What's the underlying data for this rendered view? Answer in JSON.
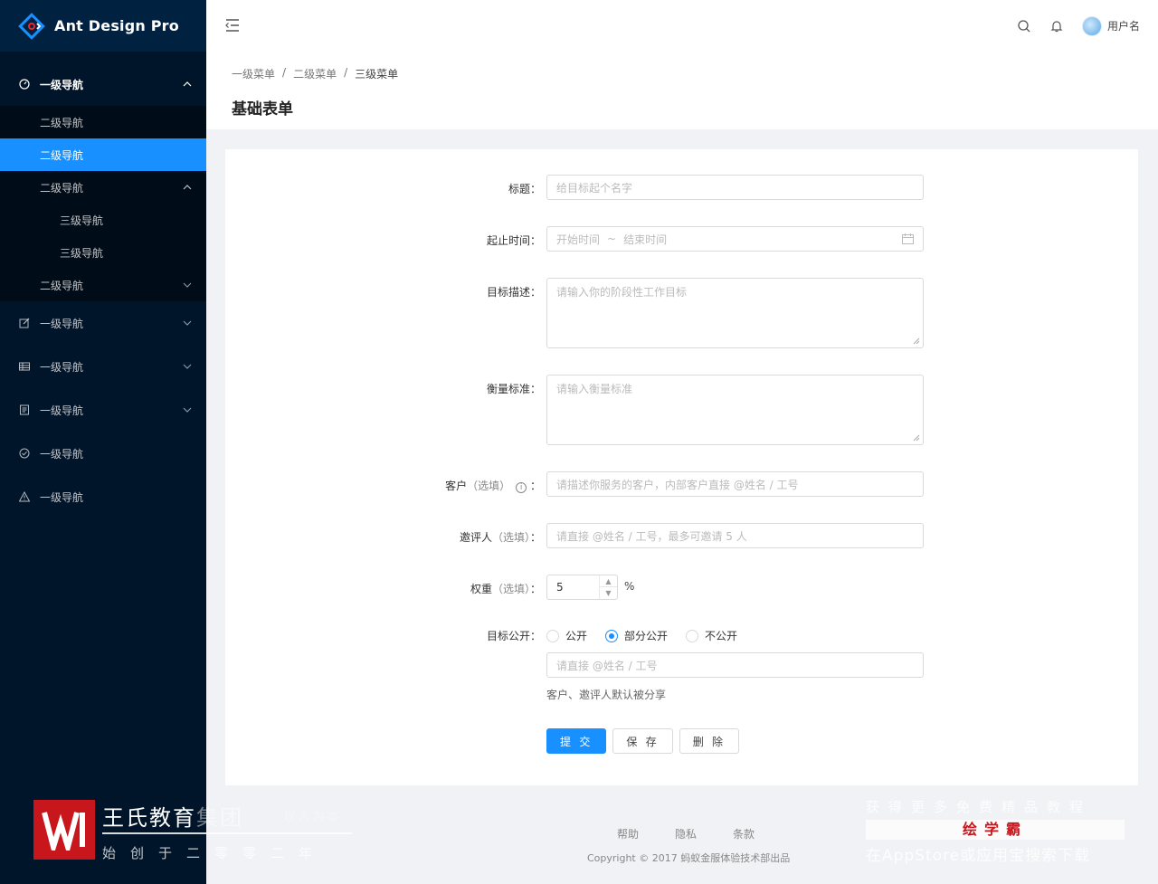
{
  "app": {
    "logo_text": "Ant Design Pro"
  },
  "sidebar": {
    "group1": {
      "label": "一级导航"
    },
    "group1_items": [
      {
        "label": "二级导航"
      },
      {
        "label": "二级导航"
      },
      {
        "label": "二级导航"
      }
    ],
    "level3_items": [
      {
        "label": "三级导航"
      },
      {
        "label": "三级导航"
      }
    ],
    "group1_last": {
      "label": "二级导航"
    },
    "top_items": [
      {
        "label": "一级导航",
        "icon": "edit-icon"
      },
      {
        "label": "一级导航",
        "icon": "table-icon"
      },
      {
        "label": "一级导航",
        "icon": "profile-icon"
      },
      {
        "label": "一级导航",
        "icon": "check-circle-icon"
      },
      {
        "label": "一级导航",
        "icon": "warning-icon"
      }
    ]
  },
  "header": {
    "username": "用户名"
  },
  "breadcrumb": {
    "items": [
      "一级菜单",
      "二级菜单",
      "三级菜单"
    ],
    "separator": "/"
  },
  "page": {
    "title": "基础表单"
  },
  "form": {
    "title": {
      "label": "标题",
      "placeholder": "给目标起个名字"
    },
    "date": {
      "label": "起止时间",
      "start_placeholder": "开始时间",
      "separator": "~",
      "end_placeholder": "结束时间"
    },
    "goal": {
      "label": "目标描述",
      "placeholder": "请输入你的阶段性工作目标"
    },
    "standard": {
      "label": "衡量标准",
      "placeholder": "请输入衡量标准"
    },
    "client": {
      "label": "客户",
      "optional": "（选填）",
      "placeholder": "请描述你服务的客户，内部客户直接 @姓名 / 工号"
    },
    "invites": {
      "label": "邀评人",
      "optional": "（选填）",
      "placeholder": "请直接 @姓名 / 工号，最多可邀请 5 人"
    },
    "weight": {
      "label": "权重",
      "optional": "（选填）",
      "value": "5",
      "unit": "%"
    },
    "public": {
      "label": "目标公开",
      "options": [
        "公开",
        "部分公开",
        "不公开"
      ],
      "selected": "部分公开",
      "target_placeholder": "请直接 @姓名 / 工号",
      "hint": "客户、邀评人默认被分享"
    },
    "buttons": {
      "submit": "提 交",
      "save": "保 存",
      "delete": "删 除"
    }
  },
  "footer": {
    "links": [
      "帮助",
      "隐私",
      "条款"
    ],
    "copyright": "Copyright © 2017 蚂蚁金服体验技术部出品"
  },
  "watermark_left": {
    "name_main": "王氏教育",
    "name_faint": "集团",
    "tagline": "以人为本",
    "sub": "始创于二零零二年"
  },
  "watermark_right": {
    "line1": "获得更多免费精品教程",
    "brand": "绘学霸",
    "line3": "在AppStore或应用宝搜索下载"
  },
  "colors": {
    "sidebar": "#001529",
    "primary": "#1890ff",
    "background": "#f0f2f5"
  }
}
